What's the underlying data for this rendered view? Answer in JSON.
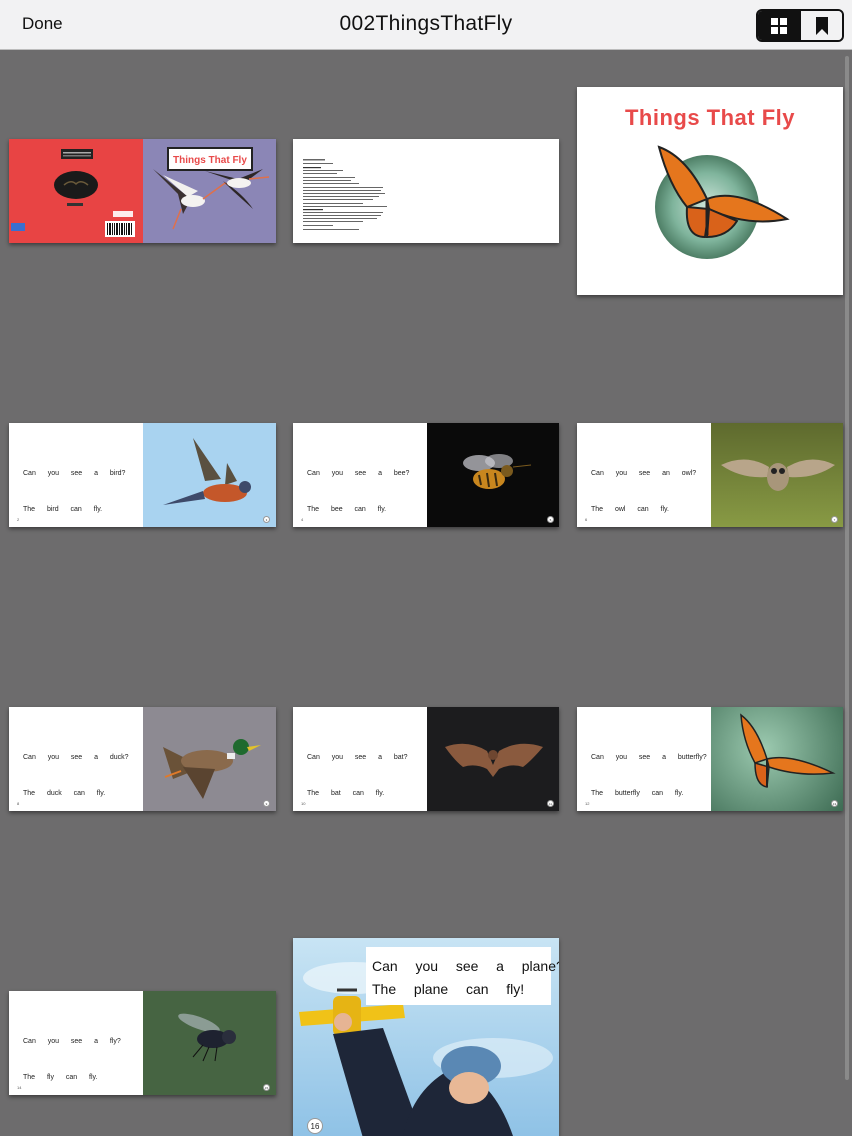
{
  "nav": {
    "done_label": "Done",
    "title": "002ThingsThatFly",
    "view_modes": [
      {
        "icon": "grid-icon",
        "active": true
      },
      {
        "icon": "bookmark-icon",
        "active": false
      }
    ]
  },
  "pages": {
    "cover": {
      "right_title": "Things That Fly"
    },
    "title_page": {
      "title": "Things That Fly"
    },
    "spreads": [
      {
        "line1": "Can  you  see  a  bird?",
        "line2": "The  bird  can  fly.",
        "left_num": "2",
        "right_num": "3"
      },
      {
        "line1": "Can  you  see  a  bee?",
        "line2": "The  bee  can  fly.",
        "left_num": "4",
        "right_num": "5"
      },
      {
        "line1": "Can  you  see  an  owl?",
        "line2": "The  owl  can  fly.",
        "left_num": "6",
        "right_num": "7"
      },
      {
        "line1": "Can  you  see  a  duck?",
        "line2": "The  duck  can  fly.",
        "left_num": "8",
        "right_num": "9"
      },
      {
        "line1": "Can  you  see  a  bat?",
        "line2": "The  bat  can  fly.",
        "left_num": "10",
        "right_num": "11"
      },
      {
        "line1": "Can  you  see  a  butterfly?",
        "line2": "The  butterfly  can  fly.",
        "left_num": "12",
        "right_num": "13"
      },
      {
        "line1": "Can  you  see  a  fly?",
        "line2": "The  fly  can  fly.",
        "left_num": "14",
        "right_num": "15"
      }
    ],
    "last": {
      "line1": "Can  you  see  a  plane?",
      "line2": "The  plane  can  fly!",
      "page_num": "16"
    }
  },
  "colors": {
    "background": "#6d6c6d",
    "title_red": "#e84a4a",
    "cover_red": "#e84444",
    "cover_purple": "#8b86b6"
  }
}
